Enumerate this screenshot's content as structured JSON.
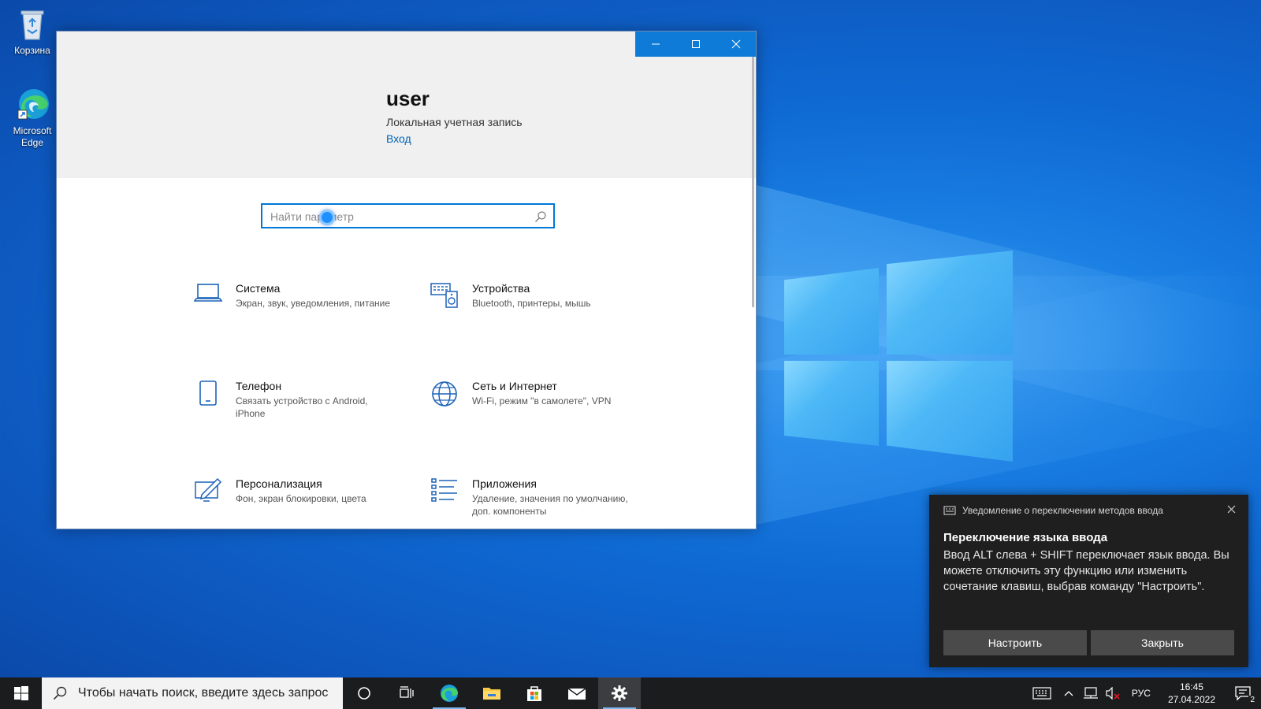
{
  "desktop": {
    "icons": [
      {
        "label": "Корзина",
        "icon": "recycle-bin-icon"
      },
      {
        "label_line1": "Microsoft",
        "label_line2": "Edge",
        "icon": "edge-icon"
      }
    ]
  },
  "settings_window": {
    "controls": {
      "minimize": "minimize-icon",
      "maximize": "maximize-icon",
      "close": "close-icon"
    },
    "user": {
      "name": "user",
      "account_type": "Локальная учетная запись",
      "login_link": "Вход"
    },
    "search": {
      "placeholder": "Найти параметр"
    },
    "tiles": [
      {
        "title": "Система",
        "desc": "Экран, звук, уведомления, питание",
        "icon": "laptop-icon"
      },
      {
        "title": "Устройства",
        "desc": "Bluetooth, принтеры, мышь",
        "icon": "devices-icon"
      },
      {
        "title": "Телефон",
        "desc": "Связать устройство с Android, iPhone",
        "icon": "phone-icon"
      },
      {
        "title": "Сеть и Интернет",
        "desc": "Wi-Fi, режим \"в самолете\", VPN",
        "icon": "globe-icon"
      },
      {
        "title": "Персонализация",
        "desc": "Фон, экран блокировки, цвета",
        "icon": "personalization-icon"
      },
      {
        "title": "Приложения",
        "desc": "Удаление, значения по умолчанию, доп. компоненты",
        "icon": "apps-list-icon"
      }
    ]
  },
  "toast": {
    "header": "Уведомление о переключении методов ввода",
    "title": "Переключение языка ввода",
    "body": "Ввод ALT слева + SHIFT переключает язык ввода. Вы можете отключить эту функцию или изменить сочетание клавиш, выбрав команду \"Настроить\".",
    "buttons": {
      "configure": "Настроить",
      "close": "Закрыть"
    }
  },
  "taskbar": {
    "search_placeholder": "Чтобы начать поиск, введите здесь запрос",
    "apps": [
      "cortana-icon",
      "task-view-icon",
      "edge-icon",
      "file-explorer-icon",
      "store-icon",
      "mail-icon",
      "settings-gear-icon"
    ],
    "tray": {
      "language": "РУС",
      "time": "16:45",
      "date": "27.04.2022",
      "notification_count": "2"
    }
  },
  "colors": {
    "accent": "#0078d7",
    "link": "#0063b1",
    "taskbar": "#1b1c1e",
    "toast_bg": "#1f1f1f"
  }
}
